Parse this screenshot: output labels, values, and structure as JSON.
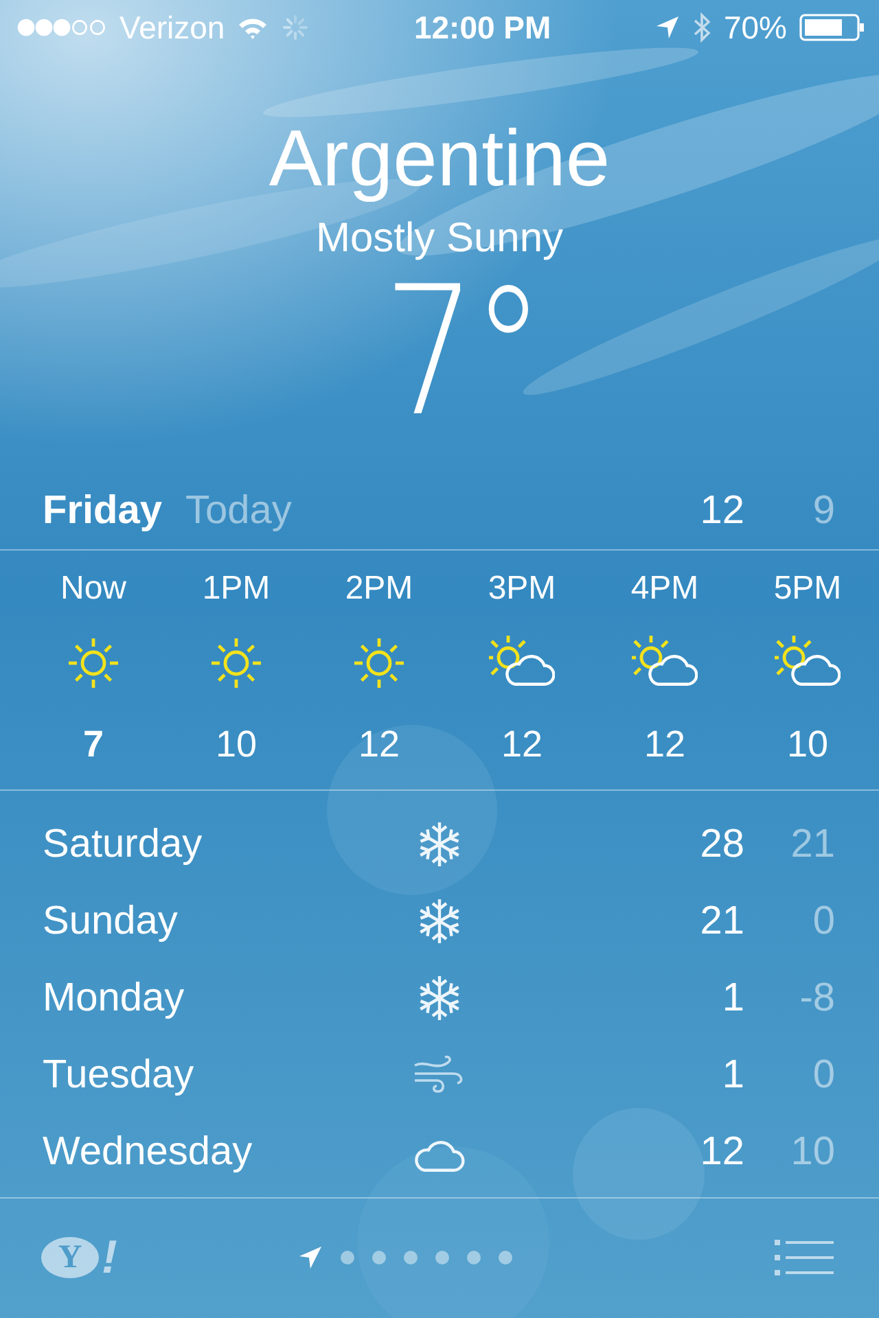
{
  "status_bar": {
    "carrier": "Verizon",
    "time": "12:00 PM",
    "battery": "70%"
  },
  "city": "Argentine",
  "condition": "Mostly Sunny",
  "temperature": "7°",
  "today": {
    "day": "Friday",
    "label": "Today",
    "high": "12",
    "low": "9"
  },
  "hourly": [
    {
      "time": "Now",
      "kind": "sun",
      "temp": "7",
      "now": true
    },
    {
      "time": "1PM",
      "kind": "sun",
      "temp": "10",
      "now": false
    },
    {
      "time": "2PM",
      "kind": "sun",
      "temp": "12",
      "now": false
    },
    {
      "time": "3PM",
      "kind": "partly-cloudy",
      "temp": "12",
      "now": false
    },
    {
      "time": "4PM",
      "kind": "partly-cloudy",
      "temp": "12",
      "now": false
    },
    {
      "time": "5PM",
      "kind": "partly-cloudy",
      "temp": "10",
      "now": false
    }
  ],
  "daily": [
    {
      "day": "Saturday",
      "kind": "snow",
      "high": "28",
      "low": "21"
    },
    {
      "day": "Sunday",
      "kind": "snow",
      "high": "21",
      "low": "0"
    },
    {
      "day": "Monday",
      "kind": "snow",
      "high": "1",
      "low": "-8"
    },
    {
      "day": "Tuesday",
      "kind": "wind",
      "high": "1",
      "low": "0"
    },
    {
      "day": "Wednesday",
      "kind": "cloud",
      "high": "12",
      "low": "10"
    }
  ],
  "bottom_bar": {
    "logo_letter": "Y",
    "logo_mark": "!",
    "pages": [
      {
        "kind": "location",
        "selected": true
      },
      {
        "kind": "dot",
        "selected": false
      },
      {
        "kind": "dot",
        "selected": false
      },
      {
        "kind": "dot",
        "selected": false
      },
      {
        "kind": "dot",
        "selected": false
      },
      {
        "kind": "dot",
        "selected": false
      },
      {
        "kind": "dot",
        "selected": false
      }
    ]
  }
}
